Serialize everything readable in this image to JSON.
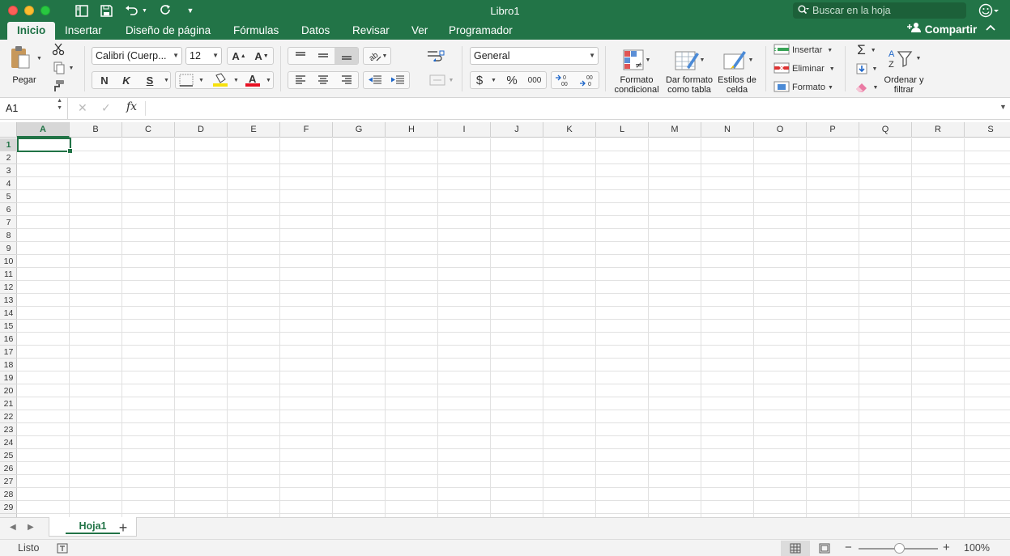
{
  "window": {
    "title": "Libro1"
  },
  "search": {
    "placeholder": "Buscar en la hoja"
  },
  "tabs": [
    "Inicio",
    "Insertar",
    "Diseño de página",
    "Fórmulas",
    "Datos",
    "Revisar",
    "Ver",
    "Programador"
  ],
  "share_label": "Compartir",
  "ribbon": {
    "paste_label": "Pegar",
    "font_name": "Calibri (Cuerp...",
    "font_size": "12",
    "bold_label": "N",
    "italic_label": "K",
    "underline_label": "S",
    "number_format": "General",
    "currency_label": "$",
    "percent_label": "%",
    "thousands_label": "000",
    "conditional_format_label": "Formato condicional",
    "format_as_table_label": "Dar formato como tabla",
    "cell_styles_label": "Estilos de celda",
    "insert_label": "Insertar",
    "delete_label": "Eliminar",
    "format_label": "Formato",
    "sort_filter_label": "Ordenar y filtrar"
  },
  "formula_bar": {
    "name_box": "A1",
    "fx_label": "fx",
    "value": ""
  },
  "columns": [
    "A",
    "B",
    "C",
    "D",
    "E",
    "F",
    "G",
    "H",
    "I",
    "J",
    "K",
    "L",
    "M",
    "N",
    "O",
    "P",
    "Q",
    "R",
    "S"
  ],
  "rows": [
    "1",
    "2",
    "3",
    "4",
    "5",
    "6",
    "7",
    "8",
    "9",
    "10",
    "11",
    "12",
    "13",
    "14",
    "15",
    "16",
    "17",
    "18",
    "19",
    "20",
    "21",
    "22",
    "23",
    "24",
    "25",
    "26",
    "27",
    "28",
    "29"
  ],
  "selected_cell": "A1",
  "sheets": [
    "Hoja1"
  ],
  "status": {
    "text": "Listo",
    "zoom": "100%"
  },
  "colors": {
    "accent": "#217346",
    "titlebar": "#227447"
  }
}
